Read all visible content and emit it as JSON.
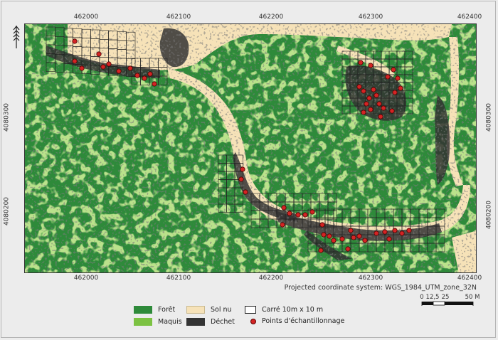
{
  "map": {
    "crs": "Projected coordinate system: WGS_1984_UTM_zone_32N",
    "x_ticks": [
      "462000",
      "462100",
      "462200",
      "462300",
      "462400"
    ],
    "y_ticks": [
      "4080300",
      "4080200"
    ],
    "colors": {
      "foret": "#2e8a3a",
      "maquis": "#7cc242",
      "sol_nu": "#f6e2b8",
      "dechet": "#333333",
      "point": "#d42424"
    },
    "north_arrow_icon": "north-arrow-icon"
  },
  "scale": {
    "labels": [
      "0",
      "12,5",
      "25",
      "50 M"
    ]
  },
  "legend": {
    "items": [
      {
        "label": "Forêt",
        "kind": "swatch",
        "color": "#2e8a3a"
      },
      {
        "label": "Maquis",
        "kind": "swatch",
        "color": "#7cc242"
      },
      {
        "label": "Sol nu",
        "kind": "swatch",
        "color": "#f6e2b8"
      },
      {
        "label": "Déchet",
        "kind": "swatch",
        "color": "#333333"
      },
      {
        "label": "Carré 10m x 10 m",
        "kind": "outline",
        "color": "#ffffff"
      },
      {
        "label": "Points d'échantillonnage",
        "kind": "dot",
        "color": "#d42424"
      }
    ]
  }
}
